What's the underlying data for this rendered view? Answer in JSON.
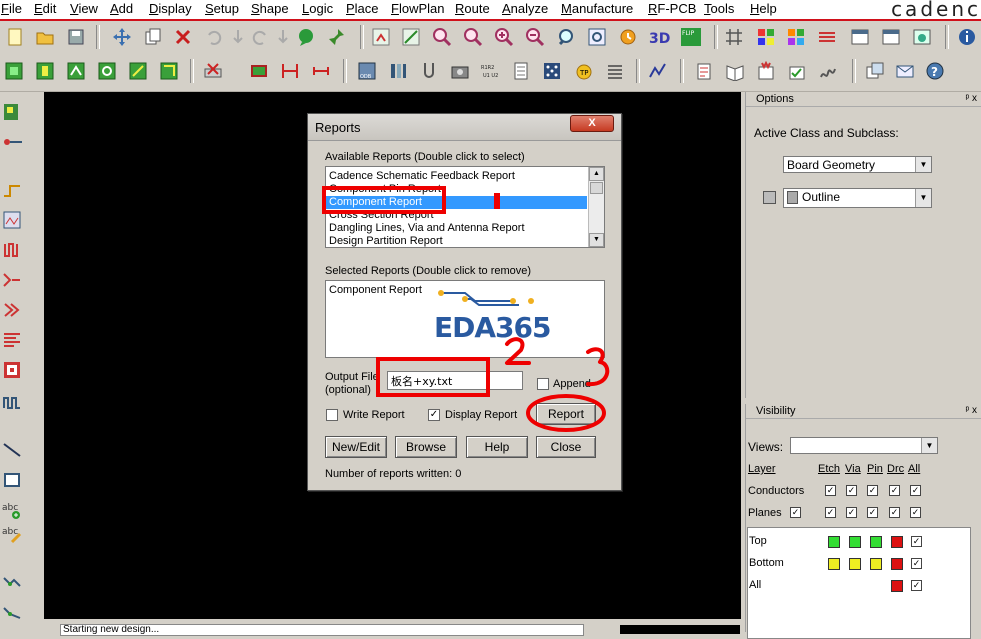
{
  "menu": {
    "items": [
      "File",
      "Edit",
      "View",
      "Add",
      "Display",
      "Setup",
      "Shape",
      "Logic",
      "Place",
      "FlowPlan",
      "Route",
      "Analyze",
      "Manufacture",
      "RF-PCB",
      "Tools",
      "Help"
    ],
    "brand": "cadenc"
  },
  "toolbar1": {
    "icons": [
      "new-file-icon",
      "open-folder-icon",
      "save-icon",
      "move-icon",
      "copy-icon",
      "delete-icon",
      "undo-icon",
      "undo-down-icon",
      "redo-icon",
      "redo-down-icon",
      "comment-icon",
      "pin-icon",
      "grid-icon",
      "grid-alt-icon",
      "zoom-fit-icon",
      "zoom-area-icon",
      "zoom-in-icon",
      "zoom-out-icon",
      "zoom-previous-icon",
      "zoom-world-icon",
      "refresh-icon",
      "3d-view-icon",
      "flip-icon",
      "grid-toggle-icon",
      "layers-icon",
      "color-icon",
      "stackup-icon",
      "constraint-icon",
      "dfa-icon",
      "dfm-icon",
      "info-icon"
    ],
    "labels": {
      "flip": "FLIP"
    }
  },
  "toolbar2": {
    "icons": [
      "route-icon",
      "connect-icon",
      "slide-icon",
      "delay-tune-icon",
      "add-via-icon",
      "fanout-icon",
      "unrib-icon",
      "place-icon",
      "dimension-icon",
      "dimension-alt-icon",
      "odb-icon",
      "matrix-icon",
      "probe-icon",
      "camera-icon",
      "refdes-icon",
      "bookmark-icon",
      "drill-icon",
      "testprep-icon",
      "swap-icon",
      "report-icon",
      "library-icon",
      "crosscheck-icon",
      "verify-icon",
      "skill-icon",
      "window-icon",
      "mail-icon",
      "help-icon"
    ],
    "labels": {
      "odb": "ODB",
      "refdes": "R1R2 U1 U2"
    }
  },
  "leftbar": {
    "icons": [
      "select-icon",
      "route-icon",
      "add-connect-icon",
      "delay-icon",
      "fanout-icon",
      "bus-icon",
      "group-icon",
      "align-icon",
      "testpoint-icon",
      "line-icon",
      "rectangle-icon",
      "text-add-icon",
      "text-edit-icon",
      "copper-shape-icon",
      "cline-icon"
    ]
  },
  "canvas": {
    "command_text": "Starting new design..."
  },
  "dialog": {
    "title": "Reports",
    "close_label": "X",
    "available_label": "Available Reports (Double click to select)",
    "available_items": [
      "Cadence Schematic Feedback Report",
      "Component Pin Report",
      "Component Report",
      "Cross Section Report",
      "Dangling Lines, Via and Antenna Report",
      "Design Partition Report"
    ],
    "selected_index": 2,
    "selected_label": "Selected Reports (Double click to remove)",
    "selected_items": [
      "Component Report"
    ],
    "watermark": "EDA365",
    "output_label_1": "Output File",
    "output_label_2": "(optional)",
    "output_value": "板名+xy.txt",
    "append_label": "Append",
    "write_report_label": "Write Report",
    "display_report_label": "Display Report",
    "report_button": "Report",
    "newedit_button": "New/Edit",
    "browse_button": "Browse",
    "help_button": "Help",
    "close_button": "Close",
    "status": "Number of reports written: 0"
  },
  "annotations": {
    "step1": "1",
    "step2": "2",
    "step3": "3",
    "color": "#ee0000"
  },
  "options": {
    "title": "Options",
    "pin": "ᵖ x",
    "active_label": "Active Class and Subclass:",
    "class_value": "Board Geometry",
    "subclass_value": "Outline"
  },
  "visibility": {
    "title": "Visibility",
    "pin": "ᵖ x",
    "views_label": "Views:",
    "views_value": "",
    "headers": [
      "Layer",
      "Etch",
      "Via",
      "Pin",
      "Drc",
      "All"
    ],
    "rows": [
      {
        "name": "Conductors"
      },
      {
        "name": "Planes"
      },
      {
        "name": "Top"
      },
      {
        "name": "Bottom"
      },
      {
        "name": "All"
      }
    ],
    "check": "✓",
    "colors": {
      "top": "#33dd33",
      "bottom": "#eeee22",
      "drc": "#dd1111"
    }
  }
}
